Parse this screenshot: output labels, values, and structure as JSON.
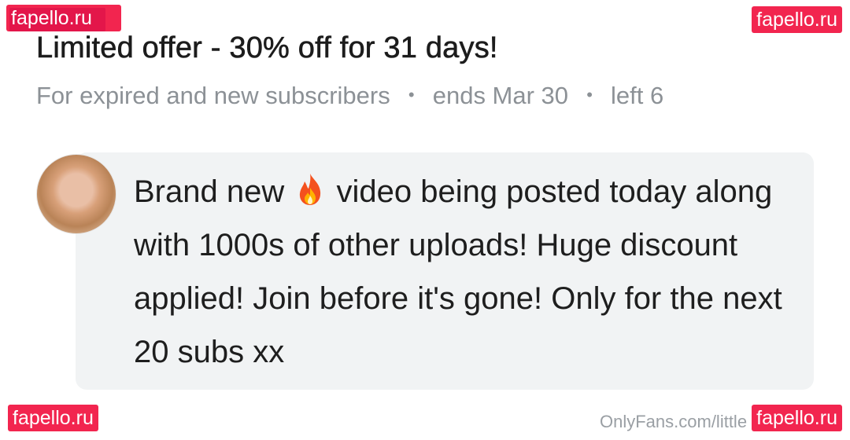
{
  "watermark": {
    "top_left": "fapello.ru",
    "top_right": "fapello.ru",
    "bottom_left": "fapello.ru",
    "bottom_right": "fapello.ru"
  },
  "offer": {
    "title": "Limited offer - 30% off for 31 days!",
    "audience": "For expired and new subscribers",
    "ends": "ends Mar 30",
    "left": "left 6",
    "separator": "•"
  },
  "message": {
    "part1": "Brand new ",
    "emoji_icon": "fire-icon",
    "part2": " video being posted today along with 1000s of other uploads! Huge discount applied! Join before it's gone! Only for the next 20 subs xx"
  },
  "footer": {
    "source": "OnlyFans.com/little"
  },
  "colors": {
    "watermark_bg": "#f2254f",
    "meta_text": "#8c9196",
    "bubble_bg": "#f1f3f4"
  }
}
